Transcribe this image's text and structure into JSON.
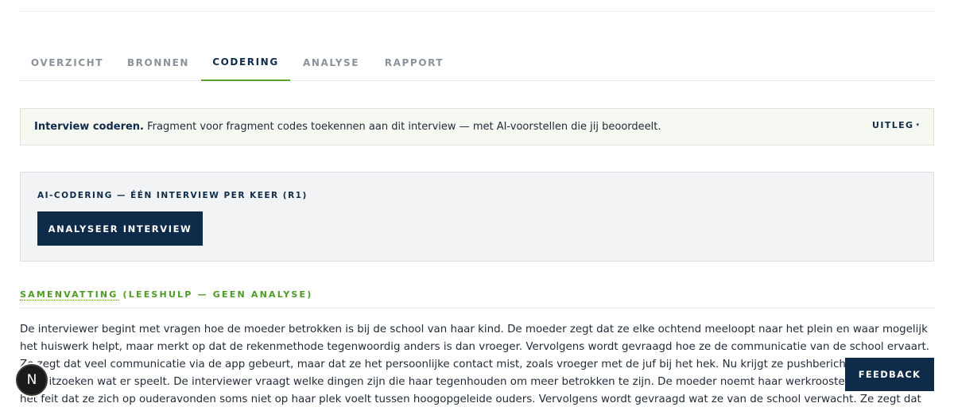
{
  "tabs": [
    {
      "label": "OVERZICHT",
      "active": false
    },
    {
      "label": "BRONNEN",
      "active": false
    },
    {
      "label": "CODERING",
      "active": true
    },
    {
      "label": "ANALYSE",
      "active": false
    },
    {
      "label": "RAPPORT",
      "active": false
    }
  ],
  "info": {
    "lead": "Interview coderen.",
    "text": "Fragment voor fragment codes toekennen aan dit interview — met AI-voorstellen die jij beoordeelt.",
    "toggle_label": "UITLEG",
    "toggle_caret": "▾"
  },
  "ai_panel": {
    "title": "AI-CODERING — ÉÉN INTERVIEW PER KEER (R1)",
    "button_label": "ANALYSEER INTERVIEW"
  },
  "summary": {
    "title_main": "SAMENVATTING",
    "title_rest": " (LEESHULP — GEEN ANALYSE)",
    "body": "De interviewer begint met vragen hoe de moeder betrokken is bij de school van haar kind. De moeder zegt dat ze elke ochtend meeloopt naar het plein en waar mogelijk het huiswerk helpt, maar merkt op dat de rekenmethode tegenwoordig anders is dan vroeger. Vervolgens wordt gevraagd hoe ze de communicatie van de school ervaart. Ze zegt dat veel communicatie via de app gebeurt, maar dat ze het persoonlijke contact mist, zoals vroeger met de juf bij het hek. Nu krijgt ze pushberichten en moet ze zelf uitzoeken wat er speelt. De interviewer vraagt welke dingen zijn die haar tegenhouden om meer betrokken te zijn. De moeder noemt haar werkrooster in de zorg en het feit dat ze zich op ouderavonden soms niet op haar plek voelt tussen hoogopgeleide ouders. Vervolgens wordt gevraagd wat ze van de school verwacht. Ze zegt dat ze wil dat de school eerlijk is als het niet goed gaat, niet pas bij het rapport, maar"
  },
  "avatar": {
    "letter": "N"
  },
  "feedback": {
    "label": "FEEDBACK"
  },
  "colors": {
    "navy": "#0f2b4a",
    "green": "#5aa02c",
    "info_bg": "#f6f8f2",
    "panel_bg": "#f2f3f5"
  }
}
